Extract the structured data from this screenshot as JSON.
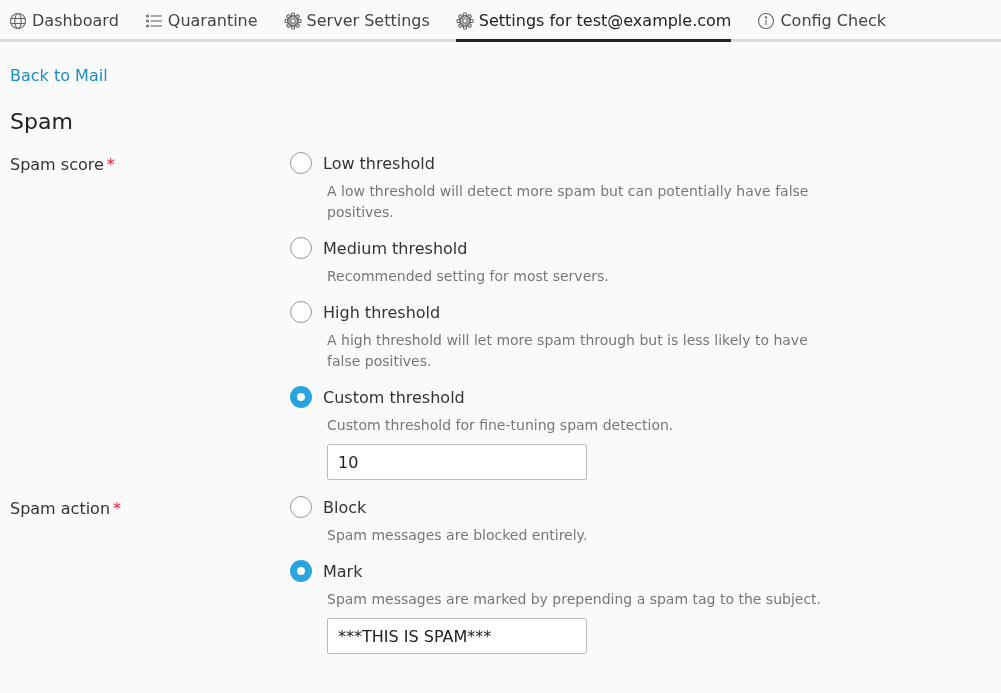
{
  "tabs": [
    {
      "label": "Dashboard",
      "selected": false
    },
    {
      "label": "Quarantine",
      "selected": false
    },
    {
      "label": "Server Settings",
      "selected": false
    },
    {
      "label": "Settings for test@example.com",
      "selected": true
    },
    {
      "label": "Config Check",
      "selected": false
    }
  ],
  "back_link": "Back to Mail",
  "section_title": "Spam",
  "fields": [
    {
      "label": "Spam score",
      "required": true,
      "required_mark": "*",
      "options": [
        {
          "label": "Low threshold",
          "selected": false,
          "description": "A low threshold will detect more spam but can potentially have false positives."
        },
        {
          "label": "Medium threshold",
          "selected": false,
          "description": "Recommended setting for most servers."
        },
        {
          "label": "High threshold",
          "selected": false,
          "description": "A high threshold will let more spam through but is less likely to have false positives."
        },
        {
          "label": "Custom threshold",
          "selected": true,
          "description": "Custom threshold for fine-tuning spam detection.",
          "value": "10"
        }
      ]
    },
    {
      "label": "Spam action",
      "required": true,
      "required_mark": "*",
      "options": [
        {
          "label": "Block",
          "selected": false,
          "description": "Spam messages are blocked entirely."
        },
        {
          "label": "Mark",
          "selected": true,
          "description": "Spam messages are marked by prepending a spam tag to the subject.",
          "value": "***THIS IS SPAM***"
        }
      ]
    }
  ]
}
